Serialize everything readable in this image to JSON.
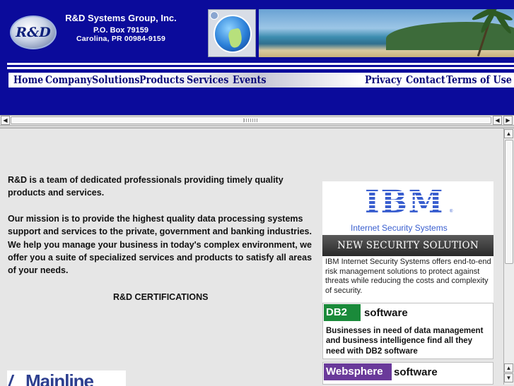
{
  "header": {
    "logo_text": "R&D",
    "company_name": "R&D Systems Group, Inc.",
    "po_box": "P.O. Box 79159",
    "city": "Carolina, PR 00984-9159"
  },
  "nav": {
    "left": [
      "Home",
      "Company",
      "Solutions",
      "Products",
      "Services",
      "Events"
    ],
    "right": [
      "Privacy",
      "Contact",
      "Terms of Use"
    ]
  },
  "scrollbars": {
    "left_arrow": "◀",
    "right_arrow": "▶",
    "up_arrow": "▲",
    "down_arrow": "▼"
  },
  "content": {
    "intro": "R&D is a team of dedicated professionals providing timely quality products and services.",
    "mission": "Our mission is to provide the highest quality data processing systems support and services to the private, government and banking industries. We help you manage your business in today's complex environment, we offer you a suite of specialized services and products to satisfy all areas of your needs.",
    "certifications_heading": "R&D CERTIFICATIONS",
    "mainline_logo": "Mainline"
  },
  "sidebar": {
    "ibm": {
      "logo": "IBM",
      "reg": "®",
      "subtitle": "Internet Security Systems",
      "banner": "NEW SECURITY SOLUTION",
      "description": "IBM Internet Security Systems offers end-to-end risk management solutions to protect against threats while reducing the costs and complexity of security."
    },
    "db2": {
      "tag": "DB2",
      "label": "software",
      "description": "Businesses in need of data management and business intelligence find all they need with DB2 software"
    },
    "websphere": {
      "tag": "Websphere",
      "label": "software"
    }
  }
}
